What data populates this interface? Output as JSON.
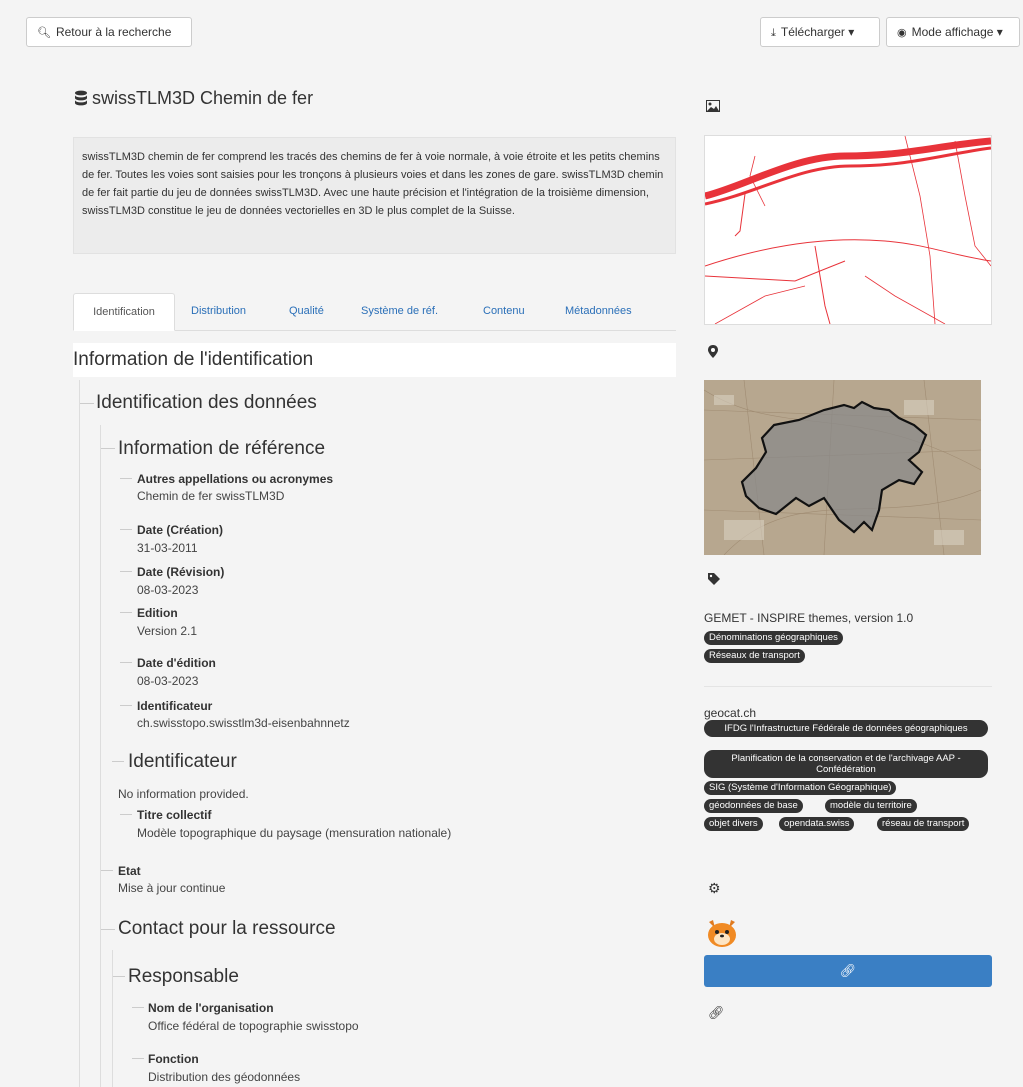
{
  "toolbar": {
    "back_label": "Retour à la recherche",
    "download_label": "Télécharger",
    "display_mode_label": "Mode affichage"
  },
  "record": {
    "title": "swissTLM3D Chemin de fer",
    "abstract": "swissTLM3D chemin de fer comprend les tracés des chemins de fer à voie normale, à voie étroite et les petits chemins de fer. Toutes les voies sont saisies pour les tronçons à plusieurs voies et dans les zones de gare. swissTLM3D chemin de fer fait partie du jeu de données swissTLM3D. Avec une haute précision et l'intégration de la troisième dimension, swissTLM3D constitue le jeu de données vectorielles en 3D le plus complet de la Suisse."
  },
  "tabs": [
    "Identification",
    "Distribution",
    "Qualité",
    "Système de réf.",
    "Contenu",
    "Métadonnées"
  ],
  "sections": {
    "info_identification": "Information de l'identification",
    "identification_donnees": "Identification des données",
    "information_reference": "Information de référence",
    "identificateur_heading": "Identificateur",
    "contact_ressource": "Contact pour la ressource",
    "responsable": "Responsable"
  },
  "fields": {
    "autres_label": "Autres appellations ou acronymes",
    "autres_value": "Chemin de fer swissTLM3D",
    "date_creation_label": "Date (Création)",
    "date_creation_value": "31-03-2011",
    "date_revision_label": "Date (Révision)",
    "date_revision_value": "08-03-2023",
    "edition_label": "Edition",
    "edition_value": "Version 2.1",
    "date_edition_label": "Date d'édition",
    "date_edition_value": "08-03-2023",
    "identificateur_label": "Identificateur",
    "identificateur_value": "ch.swisstopo.swisstlm3d-eisenbahnnetz",
    "no_info": "No information provided.",
    "titre_collectif_label": "Titre collectif",
    "titre_collectif_value": "Modèle topographique du paysage (mensuration nationale)",
    "etat_label": "Etat",
    "etat_value": "Mise à jour continue",
    "org_label": "Nom de l'organisation",
    "org_value": "Office fédéral de topographie swisstopo",
    "fonction_label": "Fonction",
    "fonction_value": "Distribution des géodonnées"
  },
  "keywords": {
    "gemet_title": "GEMET - INSPIRE themes, version 1.0",
    "gemet_tags": [
      "Dénominations géographiques",
      "Réseaux de transport"
    ],
    "geocat_title": "geocat.ch",
    "geocat_tags": [
      "IFDG l'Infrastructure Fédérale de données géographiques",
      "Planification de la conservation et de l'archivage AAP - Confédération",
      "SIG (Système d'Information Géographique)",
      "géodonnées de base",
      "modèle du territoire",
      "objet divers",
      "opendata.swiss",
      "réseau de transport"
    ]
  },
  "icons": {
    "search": "search-icon",
    "download": "download-icon",
    "eye": "eye-icon",
    "database": "database-icon",
    "image": "image-icon",
    "map_marker": "map-marker-icon",
    "tag": "tag-icon",
    "gear": "gear-icon",
    "link": "link-icon"
  },
  "colors": {
    "link": "#2a6fb8",
    "primary_button": "#3a7fc4",
    "tag_bg": "#333333",
    "rail_red": "#e8333a"
  }
}
